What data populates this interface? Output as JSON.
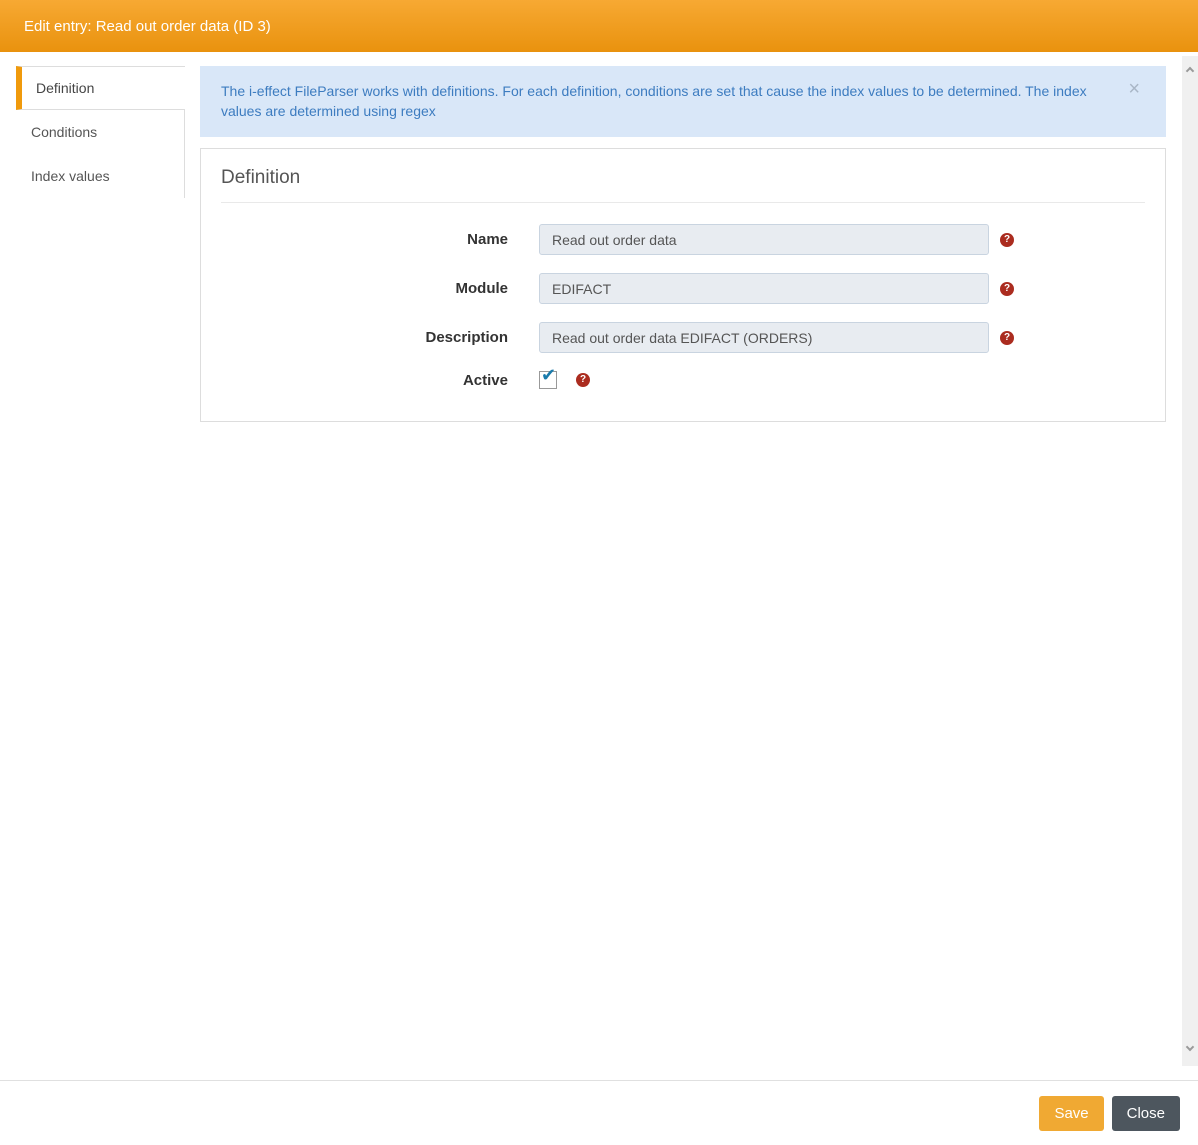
{
  "window": {
    "title": "Edit entry: Read out order data (ID 3)"
  },
  "sidebar": {
    "tabs": [
      {
        "label": "Definition",
        "active": true
      },
      {
        "label": "Conditions",
        "active": false
      },
      {
        "label": "Index values",
        "active": false
      }
    ]
  },
  "alert": {
    "message": "The i-effect FileParser works with definitions. For each definition, conditions are set that cause the index values to be determined. The index values are determined using regex",
    "close_icon": "×"
  },
  "panel": {
    "title": "Definition"
  },
  "form": {
    "fields": [
      {
        "label": "Name",
        "value": "Read out order data"
      },
      {
        "label": "Module",
        "value": "EDIFACT"
      },
      {
        "label": "Description",
        "value": "Read out order data EDIFACT (ORDERS)"
      }
    ],
    "active": {
      "label": "Active",
      "checked": true
    }
  },
  "icons": {
    "help": "?",
    "check": "✔"
  },
  "footer": {
    "save": "Save",
    "close": "Close"
  },
  "colors": {
    "header_top": "#f7a933",
    "header_bottom": "#e9920e",
    "accent_orange": "#f09a0c",
    "alert_bg": "#d9e7f8",
    "alert_text": "#3d7cc0",
    "input_bg": "#e8ecf1",
    "input_border": "#c9d4e0",
    "help_bg": "#ab2c1f",
    "check_color": "#1a7bab",
    "save_bg": "#f0a933",
    "close_bg": "#4d565e"
  }
}
